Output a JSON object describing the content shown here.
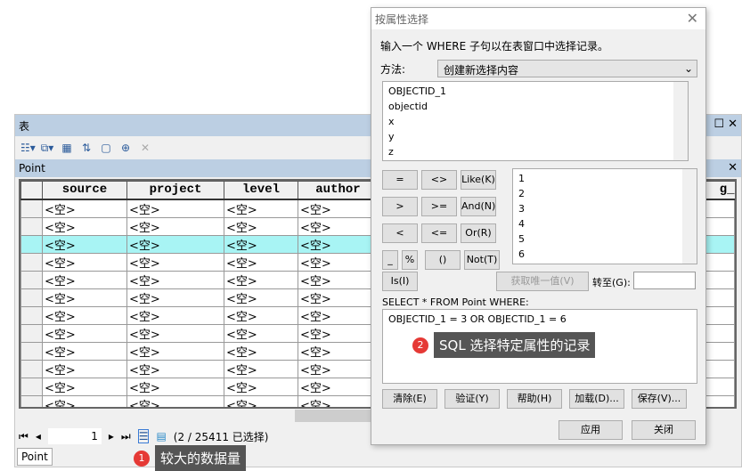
{
  "table_window": {
    "title": "表",
    "layer": "Point",
    "columns": [
      "source",
      "project",
      "level",
      "author"
    ],
    "extra_column": "g_",
    "empty_value": "<空>",
    "row_count": 12,
    "highlighted_row": 2,
    "nav": {
      "page": "1",
      "status": "(2 / 25411 已选择)"
    },
    "bottom_tab": "Point"
  },
  "dialog": {
    "title": "按属性选择",
    "instruction": "输入一个 WHERE 子句以在表窗口中选择记录。",
    "method_label": "方法:",
    "method_value": "创建新选择内容",
    "fields": [
      "OBJECTID_1",
      "objectid",
      "x",
      "y",
      "z"
    ],
    "operators": [
      [
        "=",
        "<>",
        "Like(K)"
      ],
      [
        ">",
        ">=",
        "And(N)"
      ],
      [
        "<",
        "<=",
        "Or(R)"
      ],
      [
        "_",
        "%",
        "()",
        "Not(T)"
      ]
    ],
    "is_button": "Is(I)",
    "values": [
      "1",
      "2",
      "3",
      "4",
      "5",
      "6"
    ],
    "unique_button": "获取唯一值(V)",
    "goto_label": "转至(G):",
    "sql_label": "SELECT * FROM Point WHERE:",
    "sql": "OBJECTID_1  = 3  OR  OBJECTID_1 = 6",
    "buttons": [
      "清除(E)",
      "验证(Y)",
      "帮助(H)",
      "加载(D)...",
      "保存(V)..."
    ],
    "apply": "应用",
    "close": "关闭"
  },
  "callouts": [
    {
      "num": "1",
      "text": "较大的数据量"
    },
    {
      "num": "2",
      "text": "SQL 选择特定属性的记录"
    }
  ]
}
